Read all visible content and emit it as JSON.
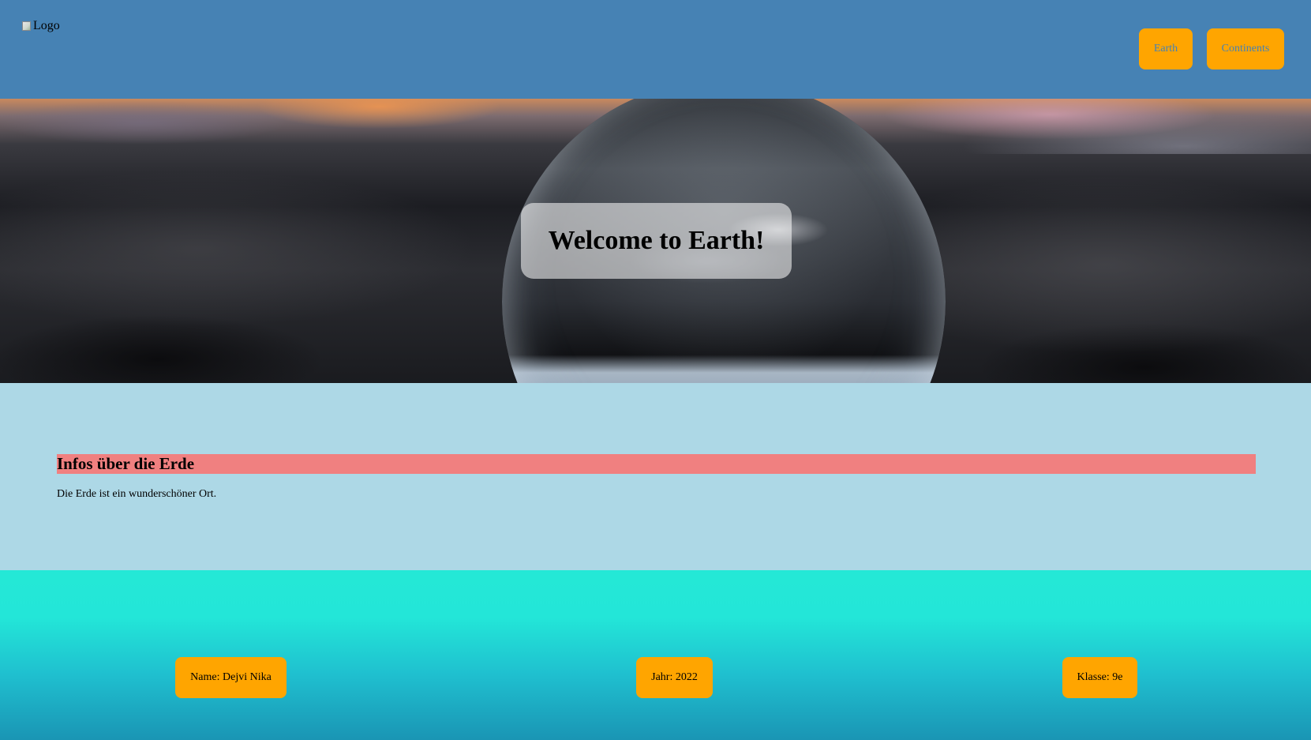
{
  "header": {
    "logo_alt": "Logo",
    "nav": [
      {
        "label": "Earth"
      },
      {
        "label": "Continents"
      }
    ],
    "colors": {
      "background": "#4682b4",
      "button": "#ffa500",
      "button_text": "#4682b4"
    }
  },
  "hero": {
    "title": "Welcome to Earth!",
    "image": "crystal-ball-landscape"
  },
  "content": {
    "heading": "Infos über die Erde",
    "text": "Die Erde ist ein wunderschöner Ort.",
    "colors": {
      "background": "#add8e6",
      "heading_background": "#f08080"
    }
  },
  "footer": {
    "name": "Name: Dejvi Nika",
    "year": "Jahr: 2022",
    "klasse": "Klasse: 9e",
    "colors": {
      "gradient_top": "#24e8d6",
      "gradient_bottom": "#1a95b4",
      "box": "#ffa500"
    }
  }
}
